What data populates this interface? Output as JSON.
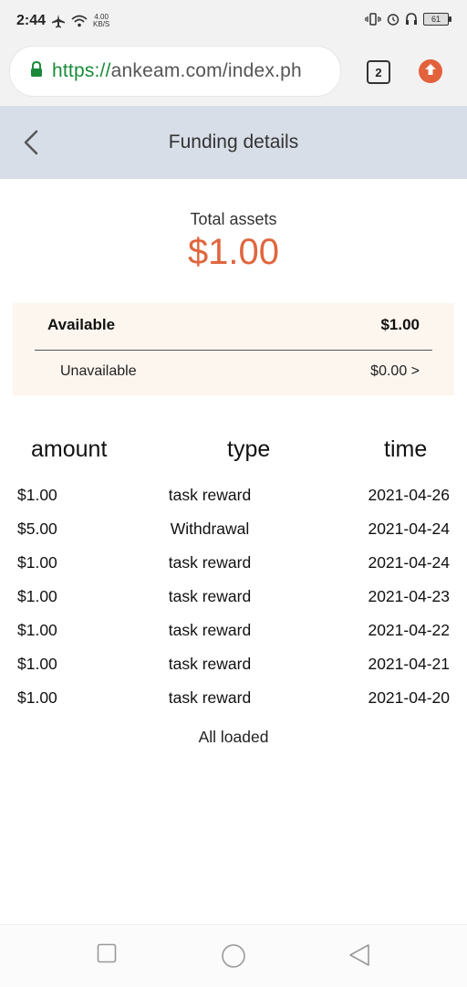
{
  "status_bar": {
    "time": "2:44",
    "net_speed_value": "4.00",
    "net_speed_unit": "KB/S",
    "battery": "61"
  },
  "browser": {
    "url_scheme": "https://",
    "url_rest": "ankeam.com/index.ph",
    "tab_count": "2"
  },
  "header": {
    "title": "Funding details"
  },
  "summary": {
    "total_label": "Total assets",
    "total_value": "$1.00",
    "available_label": "Available",
    "available_value": "$1.00",
    "unavailable_label": "Unavailable",
    "unavailable_value": "$0.00 >"
  },
  "table": {
    "headers": {
      "amount": "amount",
      "type": "type",
      "time": "time"
    },
    "rows": [
      {
        "amount": "$1.00",
        "type": "task reward",
        "time": "2021-04-26"
      },
      {
        "amount": "$5.00",
        "type": "Withdrawal",
        "time": "2021-04-24"
      },
      {
        "amount": "$1.00",
        "type": "task reward",
        "time": "2021-04-24"
      },
      {
        "amount": "$1.00",
        "type": "task reward",
        "time": "2021-04-23"
      },
      {
        "amount": "$1.00",
        "type": "task reward",
        "time": "2021-04-22"
      },
      {
        "amount": "$1.00",
        "type": "task reward",
        "time": "2021-04-21"
      },
      {
        "amount": "$1.00",
        "type": "task reward",
        "time": "2021-04-20"
      }
    ],
    "footer": "All loaded"
  },
  "colors": {
    "accent": "#e0663e",
    "header_bg": "#d8dee8",
    "summary_bg": "#fcf6ef",
    "url_green": "#1a8a3a"
  },
  "icons": {
    "back": "chevron-left-icon",
    "lock": "lock-icon",
    "update": "arrow-up-icon"
  }
}
